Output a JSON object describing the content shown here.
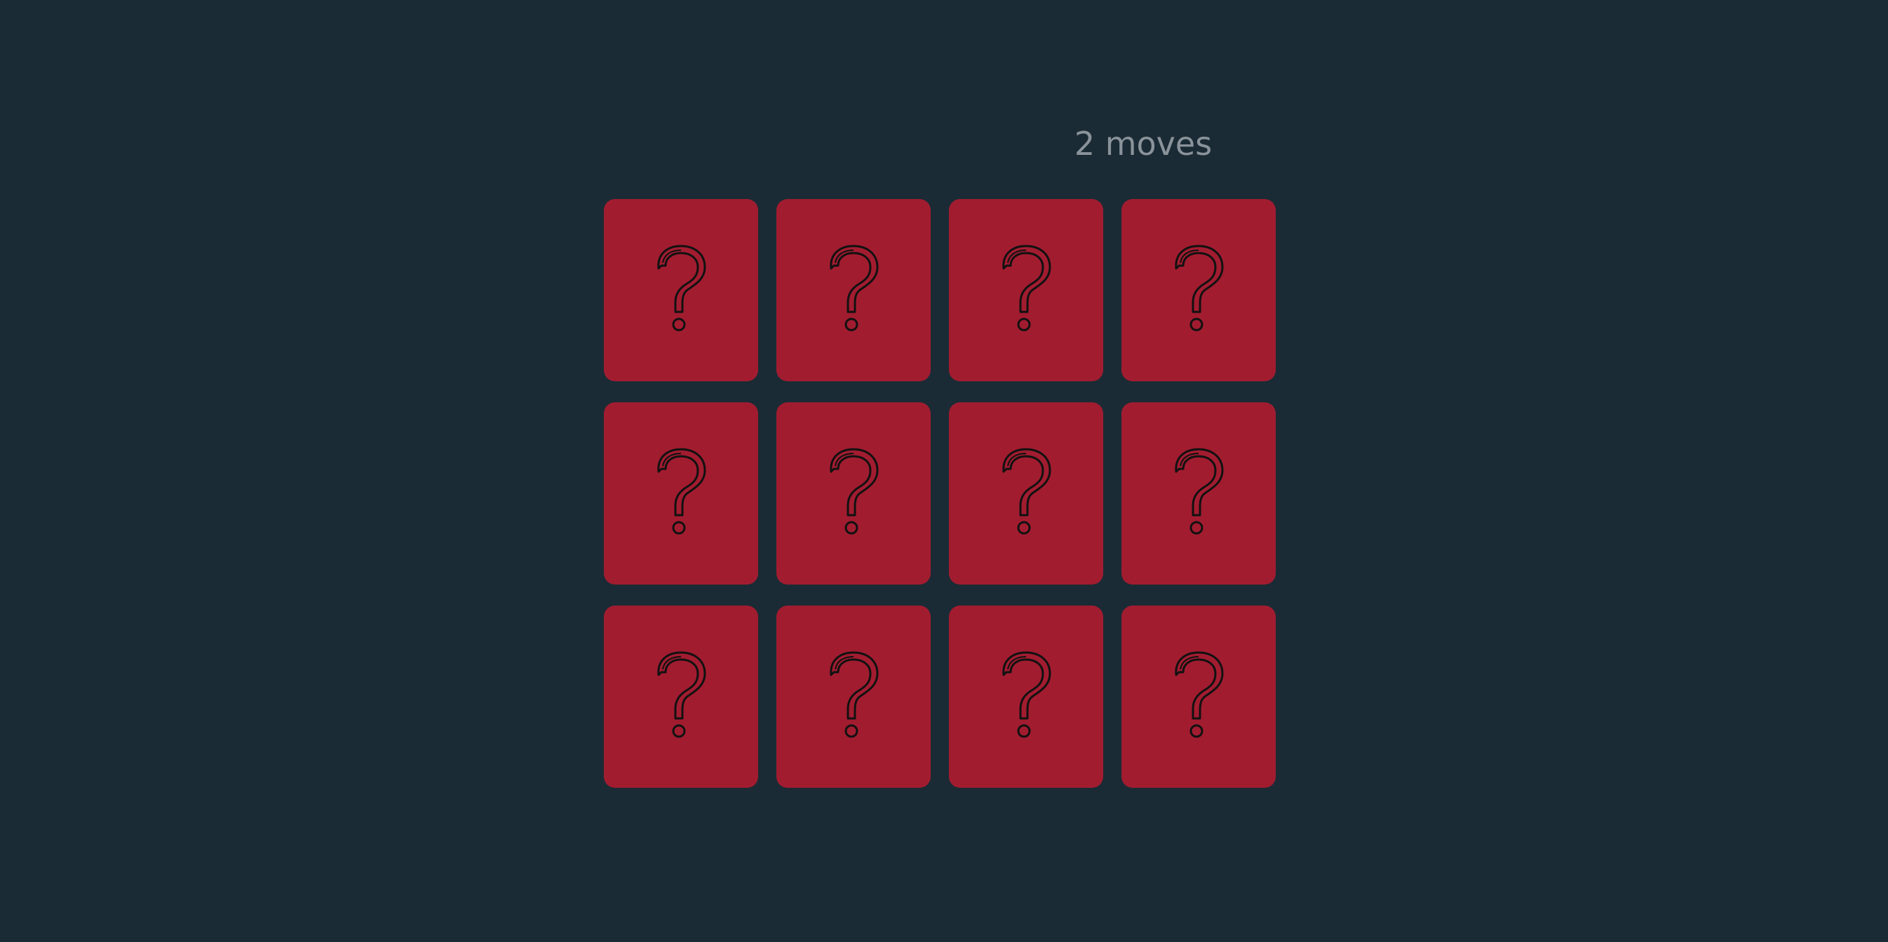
{
  "status": {
    "moves_text": "2 moves"
  },
  "board": {
    "rows": 3,
    "columns": 4,
    "cards": [
      {
        "state": "face-down",
        "icon": "question-mark-icon"
      },
      {
        "state": "face-down",
        "icon": "question-mark-icon"
      },
      {
        "state": "face-down",
        "icon": "question-mark-icon"
      },
      {
        "state": "face-down",
        "icon": "question-mark-icon"
      },
      {
        "state": "face-down",
        "icon": "question-mark-icon"
      },
      {
        "state": "face-down",
        "icon": "question-mark-icon"
      },
      {
        "state": "face-down",
        "icon": "question-mark-icon"
      },
      {
        "state": "face-down",
        "icon": "question-mark-icon"
      },
      {
        "state": "face-down",
        "icon": "question-mark-icon"
      },
      {
        "state": "face-down",
        "icon": "question-mark-icon"
      },
      {
        "state": "face-down",
        "icon": "question-mark-icon"
      },
      {
        "state": "face-down",
        "icon": "question-mark-icon"
      }
    ]
  },
  "colors": {
    "background": "#1b2b35",
    "card_back": "#a21c30",
    "moves_text": "#8a939a",
    "icon_stroke": "#111111"
  }
}
